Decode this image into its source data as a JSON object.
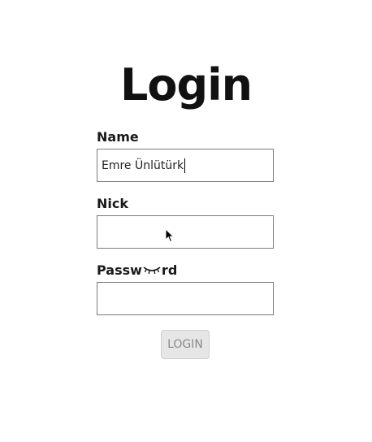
{
  "page": {
    "title": "Login"
  },
  "form": {
    "name": {
      "label": "Name",
      "value": "Emre Ünlütürk"
    },
    "nick": {
      "label": "Nick",
      "value": ""
    },
    "password": {
      "label_prefix": "Passw",
      "label_suffix": "rd",
      "value": ""
    },
    "submit_label": "LOGIN"
  },
  "icons": {
    "label_icon": "closed-eye-icon",
    "pointer": "mouse-pointer-icon"
  },
  "colors": {
    "button_bg": "#e6e6e6",
    "button_text": "#8a8a8a",
    "input_border": "#7a7a7a"
  }
}
